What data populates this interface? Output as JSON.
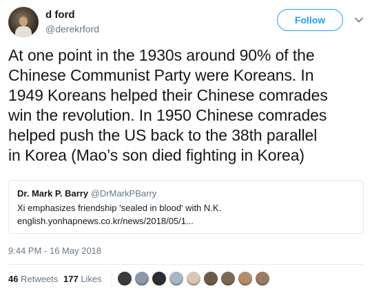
{
  "author": {
    "display_name": "d ford",
    "handle": "@derekrford"
  },
  "follow_label": "Follow",
  "tweet_text_lines": [
    "At one point in the 1930s around 90% of the",
    "Chinese Communist Party were Koreans. In",
    "1949 Koreans helped their Chinese comrades",
    "win the revolution. In 1950 Chinese comrades",
    "helped push the US back to the 38th parallel",
    "in Korea (Mao’s son died fighting in Korea)"
  ],
  "quote": {
    "name": "Dr. Mark P. Barry",
    "handle": "@DrMarkPBarry",
    "text": "Xi emphasizes friendship 'sealed in blood' with N.K.",
    "link": "english.yonhapnews.co.kr/news/2018/05/1..."
  },
  "timestamp": "9:44 PM - 16 May 2018",
  "stats": {
    "retweets_count": "46",
    "retweets_label": "Retweets",
    "likes_count": "177",
    "likes_label": "Likes"
  },
  "colors": {
    "accent": "#1da1f2",
    "text": "#14171a",
    "secondary_text": "#657786",
    "border": "#e1e8ed"
  },
  "liker_avatar_colors": [
    "#3b3b3b",
    "#8a98a8",
    "#2a2f33",
    "#a9b6c4",
    "#d9c6b8",
    "#6d5b47",
    "#7a6a55",
    "#b38a6a",
    "#9c7b63"
  ]
}
